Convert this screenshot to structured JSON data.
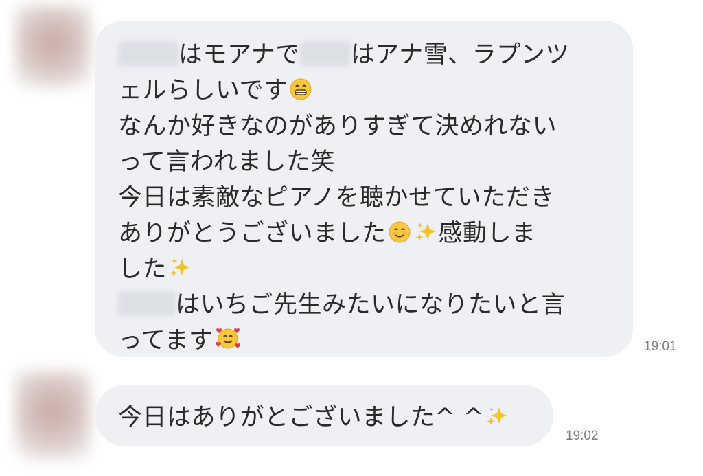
{
  "messages": [
    {
      "lines": [
        [
          "はモアナで",
          "はアナ雪、ラプンツ"
        ],
        "ェルらしいです",
        "なんか好きなのがありすぎて決めれない",
        "って言われました笑",
        "今日は素敵なピアノを聴かせていただき",
        [
          "ありがとうございました",
          "感動しま"
        ],
        "した",
        "はいちご先生みたいになりたいと言",
        "ってます"
      ],
      "time": "19:01"
    },
    {
      "text": "今日はありがとございました^ ^",
      "time": "19:02"
    }
  ],
  "icons": {
    "grin": "grinning-face-icon",
    "smile": "smiling-face-icon",
    "sparkles": "sparkles-icon",
    "hearts": "smiling-face-with-hearts-icon"
  },
  "colors": {
    "bubble": "#eef0f4",
    "text": "#2a2a2a",
    "time": "#7b7e83"
  }
}
